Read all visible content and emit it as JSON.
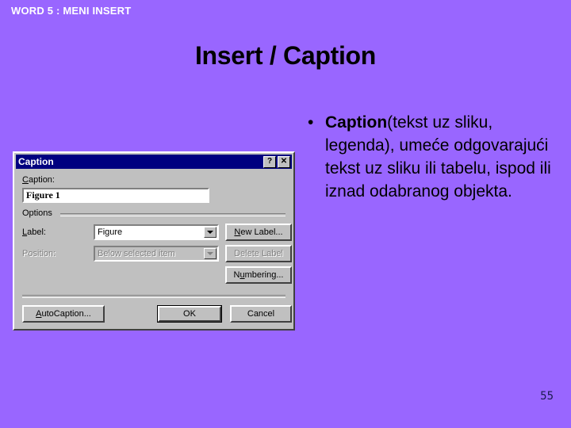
{
  "slide": {
    "header": "WORD 5 : MENI INSERT",
    "title": "Insert / Caption",
    "page_number": "55",
    "background_color": "#9966ff"
  },
  "body": {
    "bullet_mark": "•",
    "bullet_bold_lead": "Caption",
    "bullet_rest": "(tekst uz sliku, legenda), umeće odgovarajući tekst uz sliku ili tabelu, ispod ili iznad odabranog objekta."
  },
  "dialog": {
    "title": "Caption",
    "titlebar_color": "#000080",
    "face_color": "#c0c0c0",
    "help_button": "?",
    "close_button": "✕",
    "caption_field": {
      "label": "Caption:",
      "label_accesskey": "C",
      "value": "Figure 1"
    },
    "options_group": {
      "label": "Options"
    },
    "label_field": {
      "label": "Label:",
      "label_accesskey": "L",
      "value": "Figure",
      "enabled": true
    },
    "position_field": {
      "label": "Position:",
      "value": "Below selected item",
      "enabled": false
    },
    "buttons": {
      "new_label": "New Label...",
      "new_label_accesskey": "N",
      "delete_label": "Delete Label",
      "delete_label_enabled": false,
      "numbering": "Numbering...",
      "numbering_accesskey": "N",
      "autocaption": "AutoCaption...",
      "autocaption_accesskey": "A",
      "ok": "OK",
      "cancel": "Cancel"
    }
  }
}
